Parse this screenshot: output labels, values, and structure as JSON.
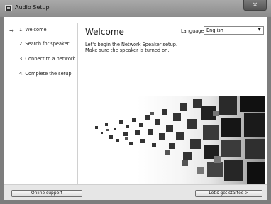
{
  "window": {
    "title": "Audio Setup",
    "close_label": "×"
  },
  "sidebar": {
    "steps": [
      {
        "label": "1. Welcome",
        "active": true
      },
      {
        "label": "2. Search for speaker",
        "active": false
      },
      {
        "label": "3. Connect to a network",
        "active": false
      },
      {
        "label": "4. Complete the setup",
        "active": false
      }
    ],
    "active_indicator": "→"
  },
  "main": {
    "heading": "Welcome",
    "language_label": "Language",
    "language_value": "English",
    "description_line1": "Let's begin the Network Speaker setup.",
    "description_line2": "Make sure the speaker is turned on."
  },
  "footer": {
    "online_support_label": "Online support",
    "get_started_label": "Let's get started >"
  }
}
